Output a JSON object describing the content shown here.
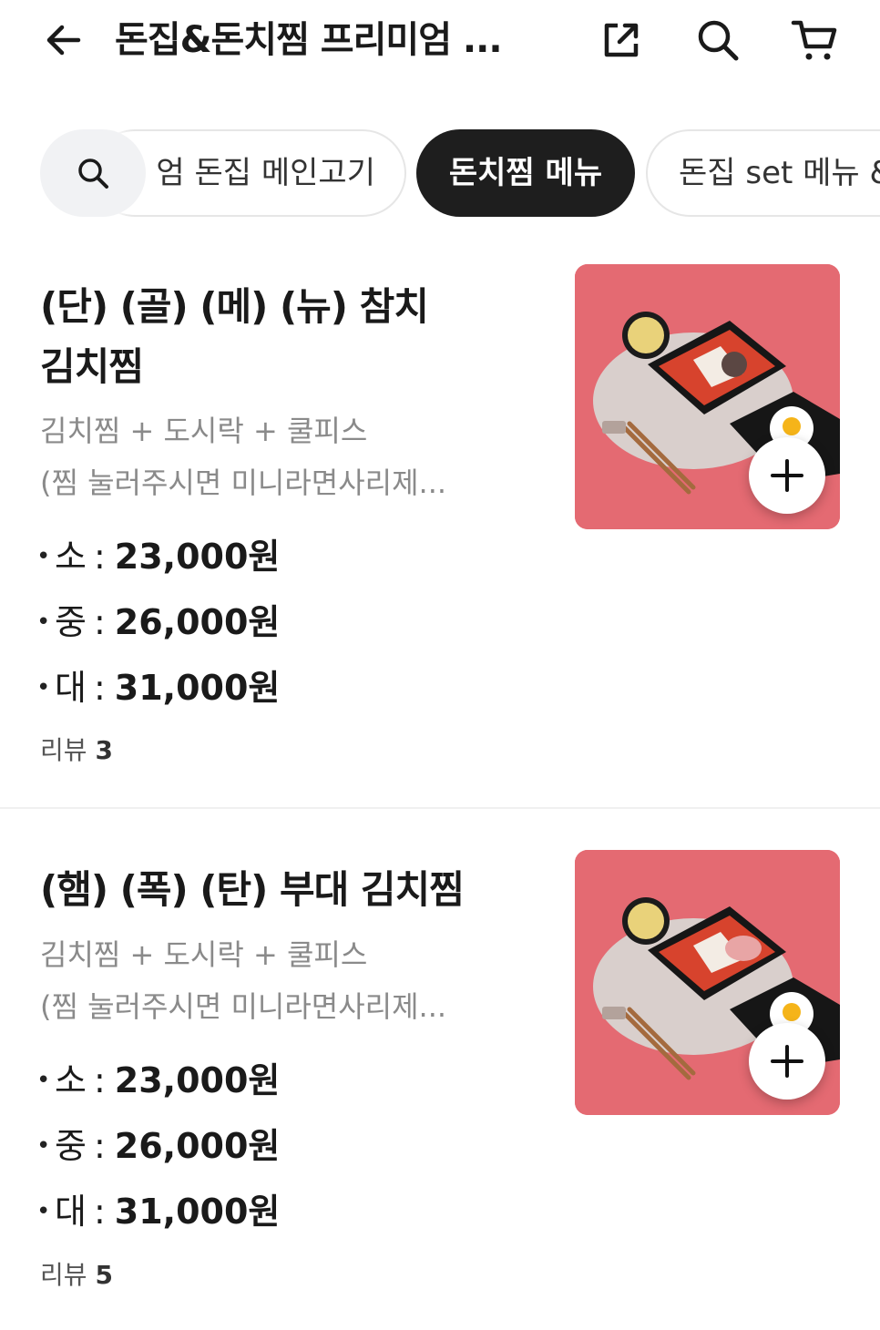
{
  "header": {
    "title": "돈집&돈치찜 프리미엄 ..."
  },
  "tabs": [
    {
      "label": "엄 돈집 메인고기"
    },
    {
      "label": "돈치찜 메뉴",
      "active": true
    },
    {
      "label": "돈집 set 메뉴 &"
    }
  ],
  "items": [
    {
      "name_line1": "(단) (골) (메) (뉴) 참치",
      "name_line2": "김치찜",
      "desc_line1": "김치찜 + 도시락 + 쿨피스",
      "desc_line2": "(찜 눌러주시면 미니라면사리제...",
      "prices": [
        {
          "size": "소",
          "price": "23,000원"
        },
        {
          "size": "중",
          "price": "26,000원"
        },
        {
          "size": "대",
          "price": "31,000원"
        }
      ],
      "review_label": "리뷰",
      "review_count": "3"
    },
    {
      "name_line1": "(햄) (폭) (탄) 부대 김치찜",
      "desc_line1": "김치찜 + 도시락 + 쿨피스",
      "desc_line2": "(찜 눌러주시면 미니라면사리제...",
      "prices": [
        {
          "size": "소",
          "price": "23,000원"
        },
        {
          "size": "중",
          "price": "26,000원"
        },
        {
          "size": "대",
          "price": "31,000원"
        }
      ],
      "review_label": "리뷰",
      "review_count": "5"
    }
  ],
  "colors": {
    "thumb_background": "#e46a72",
    "active_tab": "#1e1e1e"
  },
  "icons": [
    "back-arrow-icon",
    "share-icon",
    "search-icon",
    "cart-icon",
    "plus-icon"
  ]
}
